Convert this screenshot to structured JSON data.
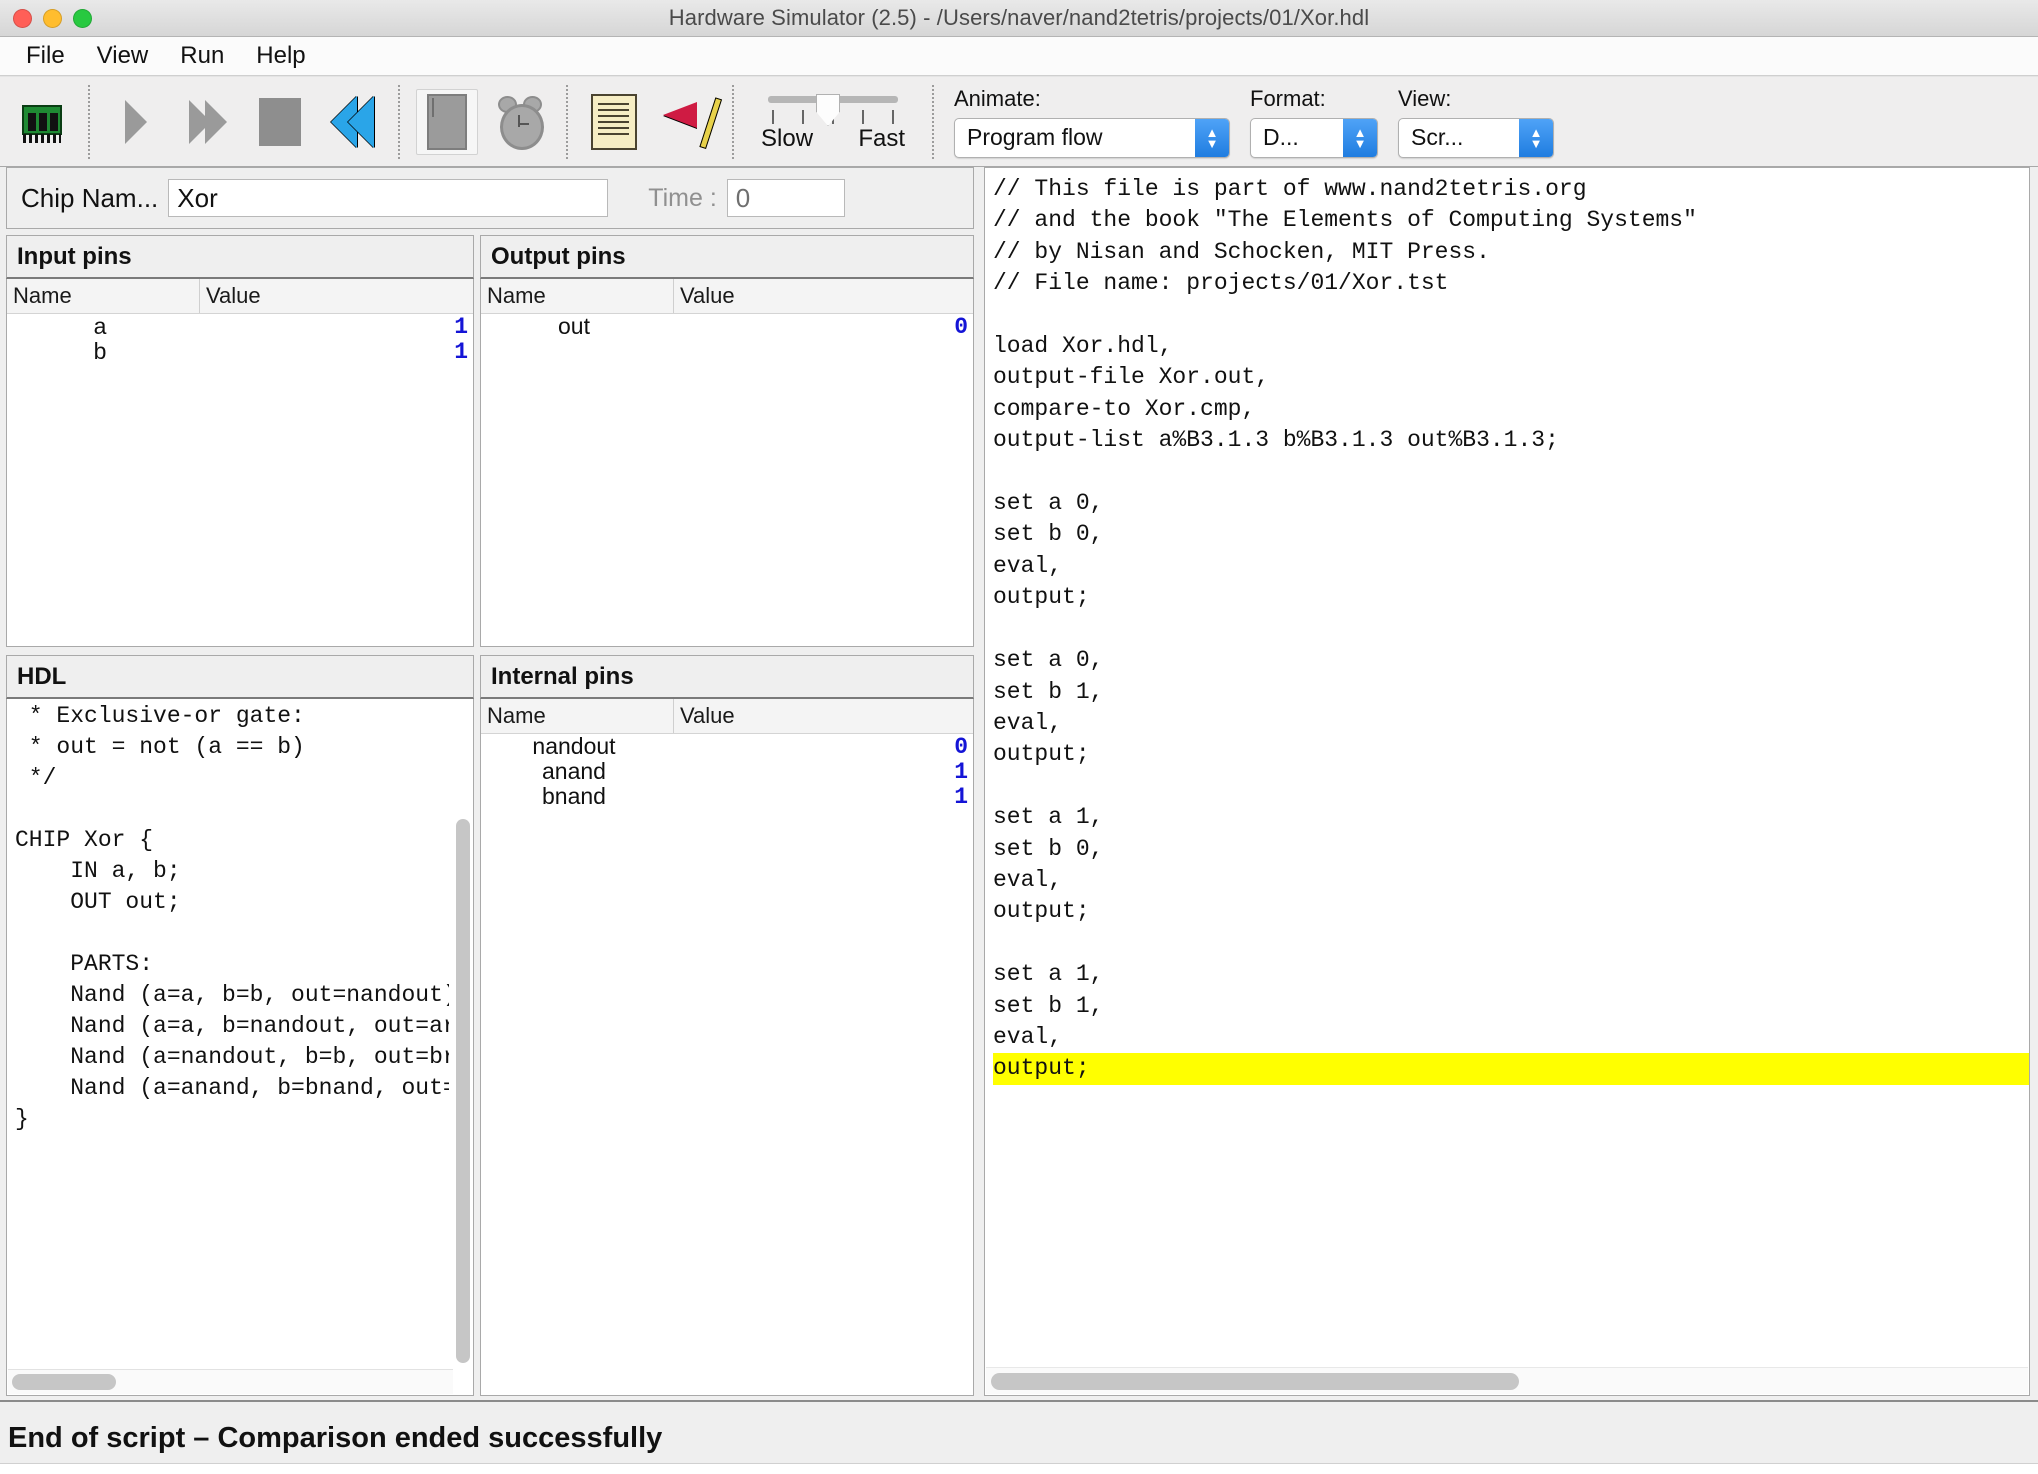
{
  "window": {
    "title": "Hardware Simulator (2.5) - /Users/naver/nand2tetris/projects/01/Xor.hdl"
  },
  "menu": {
    "items": [
      "File",
      "View",
      "Run",
      "Help"
    ]
  },
  "toolbar": {
    "buttons": [
      {
        "name": "load-chip-icon",
        "tooltip": "Load Chip"
      },
      {
        "name": "single-step-icon",
        "tooltip": "Single Step"
      },
      {
        "name": "run-icon",
        "tooltip": "Run"
      },
      {
        "name": "stop-icon",
        "tooltip": "Stop"
      },
      {
        "name": "rewind-icon",
        "tooltip": "Rewind"
      },
      {
        "name": "calculator-icon",
        "tooltip": "Calculator"
      },
      {
        "name": "clock-icon",
        "tooltip": "Clock"
      },
      {
        "name": "script-icon",
        "tooltip": "Script"
      },
      {
        "name": "compare-flag-icon",
        "tooltip": "Compare"
      }
    ],
    "speed": {
      "slow_label": "Slow",
      "fast_label": "Fast",
      "ticks": 5,
      "position": 3
    },
    "animate": {
      "label": "Animate:",
      "value": "Program flow"
    },
    "format": {
      "label": "Format:",
      "value": "D..."
    },
    "view": {
      "label": "View:",
      "value": "Scr..."
    }
  },
  "chip": {
    "name_label": "Chip Nam...",
    "name_value": "Xor",
    "time_label": "Time :",
    "time_value": "0"
  },
  "input_pins": {
    "title": "Input pins",
    "columns": [
      "Name",
      "Value"
    ],
    "rows": [
      {
        "name": "a",
        "value": "1"
      },
      {
        "name": "b",
        "value": "1"
      }
    ]
  },
  "output_pins": {
    "title": "Output pins",
    "columns": [
      "Name",
      "Value"
    ],
    "rows": [
      {
        "name": "out",
        "value": "0"
      }
    ]
  },
  "internal_pins": {
    "title": "Internal pins",
    "columns": [
      "Name",
      "Value"
    ],
    "rows": [
      {
        "name": "nandout",
        "value": "0"
      },
      {
        "name": "anand",
        "value": "1"
      },
      {
        "name": "bnand",
        "value": "1"
      }
    ]
  },
  "hdl": {
    "title": "HDL",
    "code": " * Exclusive-or gate:\n * out = not (a == b)\n */\n\nCHIP Xor {\n    IN a, b;\n    OUT out;\n\n    PARTS:\n    Nand (a=a, b=b, out=nandout)\n    Nand (a=a, b=nandout, out=ar\n    Nand (a=nandout, b=b, out=br\n    Nand (a=anand, b=bnand, out=\n}"
  },
  "script": {
    "lines_before": "// This file is part of www.nand2tetris.org\n// and the book \"The Elements of Computing Systems\"\n// by Nisan and Schocken, MIT Press.\n// File name: projects/01/Xor.tst\n\nload Xor.hdl,\noutput-file Xor.out,\ncompare-to Xor.cmp,\noutput-list a%B3.1.3 b%B3.1.3 out%B3.1.3;\n\nset a 0,\nset b 0,\neval,\noutput;\n\nset a 0,\nset b 1,\neval,\noutput;\n\nset a 1,\nset b 0,\neval,\noutput;\n\nset a 1,\nset b 1,\neval,\n",
    "highlighted_line": "output;",
    "highlight_color": "#ffff00"
  },
  "status": {
    "message": "End of script – Comparison ended successfully"
  }
}
